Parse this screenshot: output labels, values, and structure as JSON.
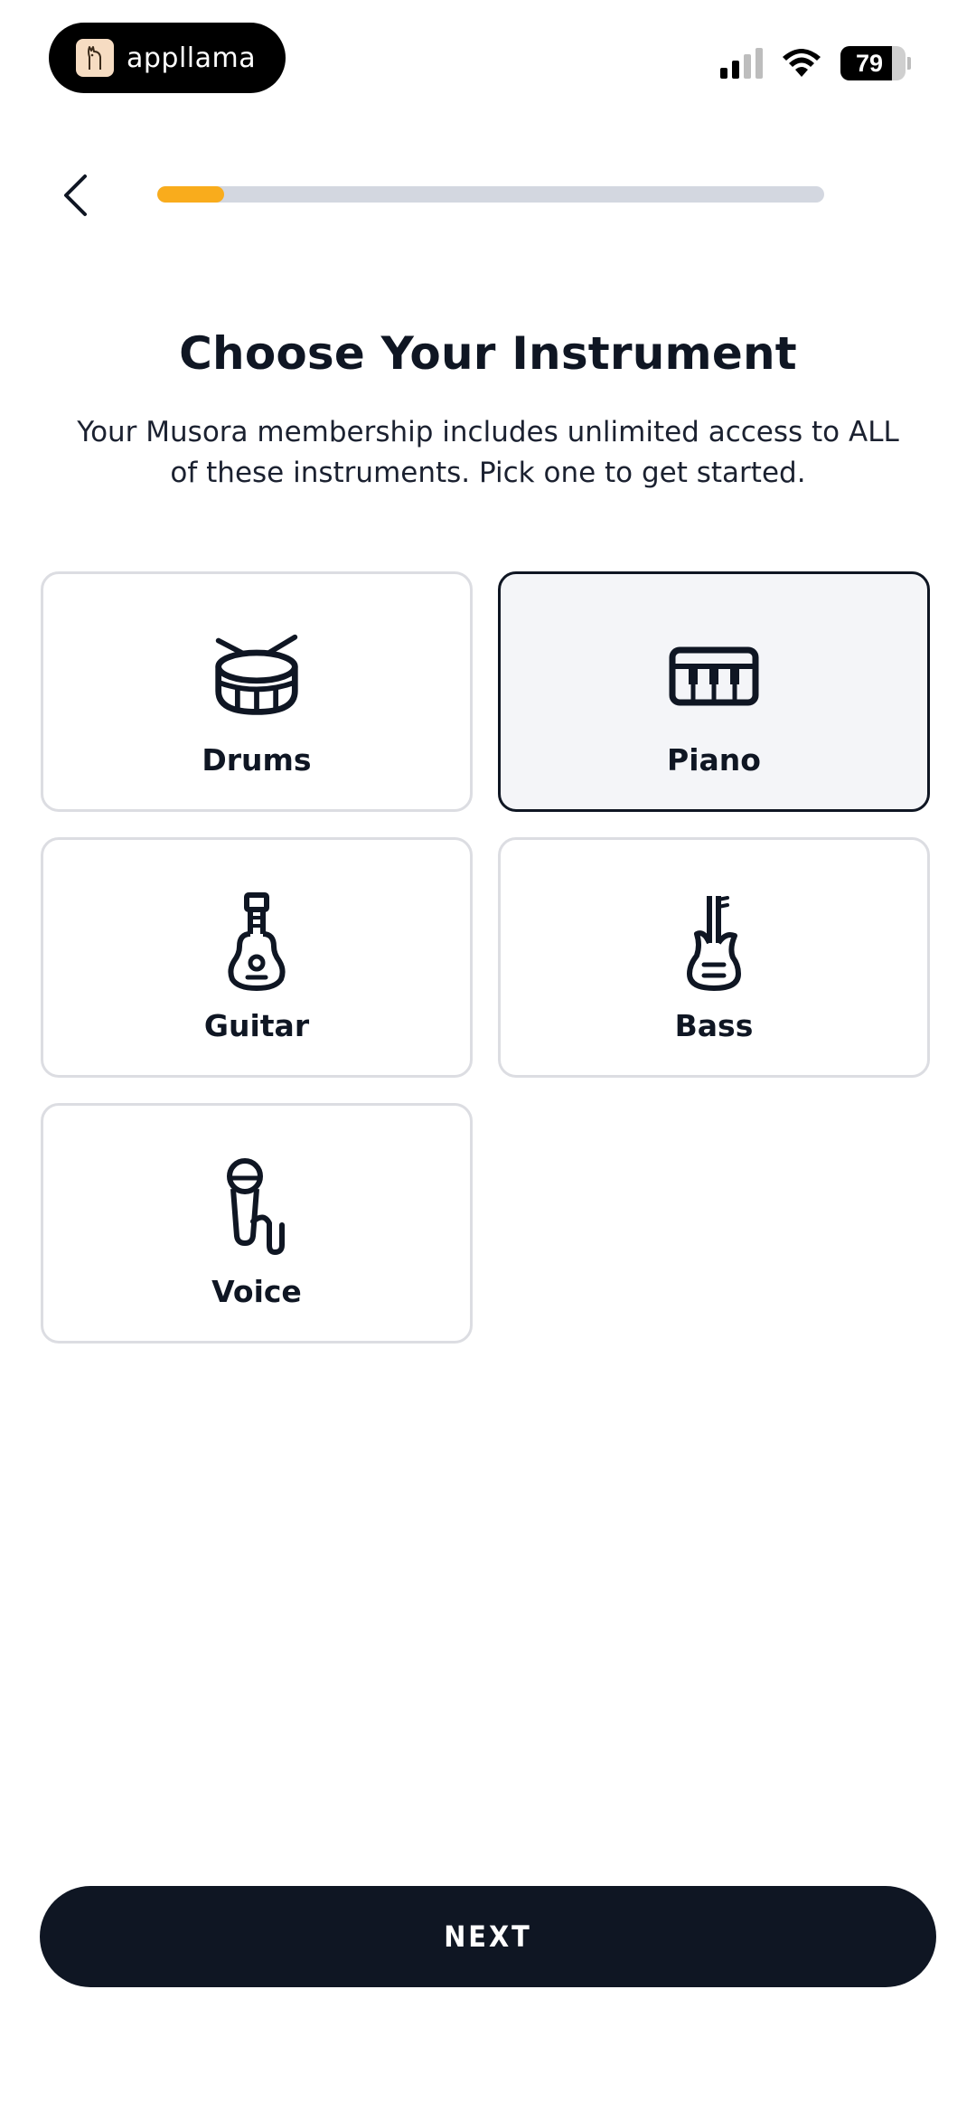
{
  "status_bar": {
    "app_name": "appllama",
    "battery_level": "79",
    "battery_fraction": 0.79,
    "signal_bars_active": 2,
    "signal_bars_total": 4
  },
  "header": {
    "progress_fraction": 0.1
  },
  "page": {
    "title": "Choose Your Instrument",
    "subtitle": "Your Musora membership includes unlimited access to ALL of these instruments. Pick one to get started."
  },
  "instruments": [
    {
      "label": "Drums",
      "icon": "drum-icon",
      "selected": false
    },
    {
      "label": "Piano",
      "icon": "piano-keyboard-icon",
      "selected": true
    },
    {
      "label": "Guitar",
      "icon": "acoustic-guitar-icon",
      "selected": false
    },
    {
      "label": "Bass",
      "icon": "bass-guitar-icon",
      "selected": false
    },
    {
      "label": "Voice",
      "icon": "microphone-icon",
      "selected": false
    }
  ],
  "footer": {
    "next_label": "NEXT"
  },
  "colors": {
    "accent": "#f9ac1c",
    "dark": "#0f1623",
    "progress_track": "#d3d7e0",
    "card_border": "#dcdde2",
    "card_selected_bg": "#f4f5f8"
  }
}
